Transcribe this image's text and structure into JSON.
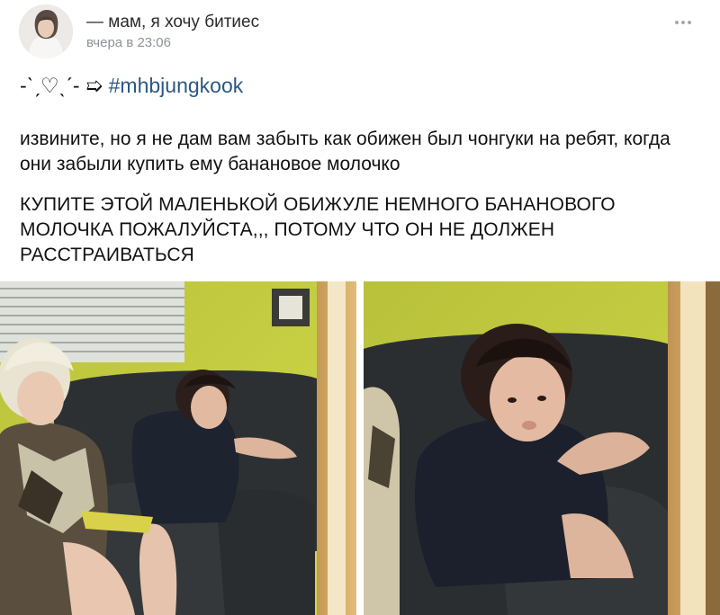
{
  "post": {
    "author_name": "— мам, я хочу битиес",
    "time": "вчера в 23:06",
    "tag_decoration": "-ˋˏ♡ˎˊ- ➯",
    "hashtag": "#mhbjungkook",
    "text_paragraph_1": "извините, но я не дам вам забыть как обижен был чонгуки на ребят, когда они забыли купить ему банановое молочко",
    "text_paragraph_2": "КУПИТЕ ЭТОЙ МАЛЕНЬКОЙ ОБИЖУЛЕ НЕМНОГО БАНАНОВОГО МОЛОЧКА ПОЖАЛУЙСТА,,, ПОТОМУ ЧТО ОН НЕ ДОЛЖЕН РАССТРАИВАТЬСЯ"
  },
  "icons": {
    "more": "more-horizontal-icon"
  },
  "colors": {
    "link": "#2a5885",
    "meta_text": "#8c9299",
    "wall": "#c6cf3a",
    "sofa": "#2e3133"
  }
}
